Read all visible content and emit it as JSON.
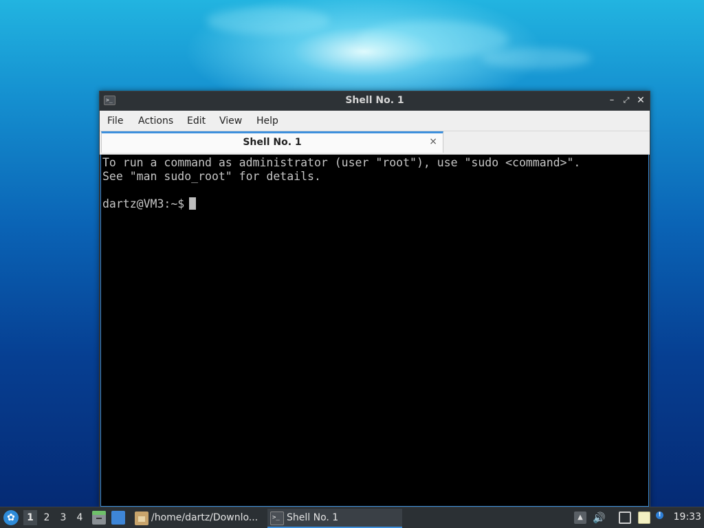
{
  "window": {
    "title": "Shell No. 1",
    "controls": {
      "minimize": "–",
      "maximize": "⤢",
      "close": "✕"
    }
  },
  "menubar": {
    "items": [
      "File",
      "Actions",
      "Edit",
      "View",
      "Help"
    ]
  },
  "tabs": [
    {
      "label": "Shell No. 1",
      "close": "×",
      "active": true
    }
  ],
  "terminal": {
    "lines": [
      "To run a command as administrator (user \"root\"), use \"sudo <command>\".",
      "See \"man sudo_root\" for details.",
      "",
      "dartz@VM3:~$"
    ]
  },
  "taskbar": {
    "workspaces": [
      "1",
      "2",
      "3",
      "4"
    ],
    "active_workspace": "1",
    "tasks": [
      {
        "label": "/home/dartz/Downlo...",
        "icon": "folder-icon"
      },
      {
        "label": "Shell No. 1",
        "icon": "terminal-icon",
        "active": true
      }
    ],
    "clock": "19:33"
  },
  "colors": {
    "accent": "#3d8fdc",
    "titlebar": "#2d3236",
    "terminal_bg": "#000000",
    "terminal_fg": "#c6c6c6"
  }
}
